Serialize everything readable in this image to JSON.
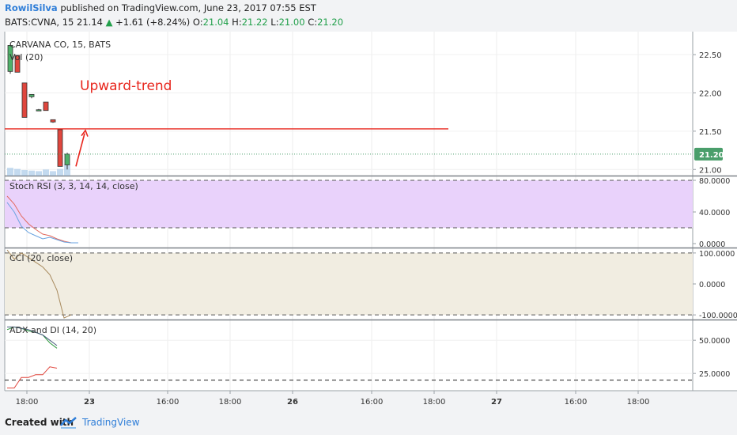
{
  "header": {
    "author": "RowilSilva",
    "published": "published on TradingView.com, June 23, 2017 07:55 EST",
    "symbol": "BATS:CVNA, 15",
    "last": "21.14",
    "arrow": "▲",
    "change": "+1.61 (+8.24%)",
    "o_label": "O:",
    "o_value": "21.04",
    "h_label": "H:",
    "h_value": "21.22",
    "l_label": "L:",
    "l_value": "21.00",
    "c_label": "C:",
    "c_value": "21.20"
  },
  "footer": {
    "created_with": "Created with",
    "brand": "TradingView"
  },
  "colors": {
    "up": "#22a04b",
    "down": "#e0463d",
    "annotation": "#e8261d",
    "rsi_fill": "#e9d2fb",
    "cci_fill": "#f1ede1",
    "price_badge": "#4a9e6b",
    "brand": "#2f7ed8"
  },
  "chart_data": [
    {
      "type": "candlestick",
      "title": "CARVANA CO, 15, BATS",
      "volume_label": "Vol (20)",
      "annotation": "Upward-trend",
      "horizontal_line_value": 21.53,
      "last_price_label": "21.20",
      "ylim": [
        20.92,
        22.8
      ],
      "yticks": [
        "22.50",
        "22.00",
        "21.50",
        "21.00"
      ],
      "x_tick_labels": [
        "18:00",
        "23",
        "16:00",
        "18:00",
        "26",
        "16:00",
        "18:00",
        "27",
        "16:00",
        "18:00"
      ],
      "bars": [
        {
          "open": 22.28,
          "high": 22.62,
          "low": 22.25,
          "close": 22.62
        },
        {
          "open": 22.49,
          "high": 22.49,
          "low": 22.27,
          "close": 22.27
        },
        {
          "open": 22.13,
          "high": 22.13,
          "low": 21.68,
          "close": 21.68
        },
        {
          "open": 21.95,
          "high": 21.98,
          "low": 21.93,
          "close": 21.98
        },
        {
          "open": 21.78,
          "high": 21.79,
          "low": 21.77,
          "close": 21.78
        },
        {
          "open": 21.88,
          "high": 21.88,
          "low": 21.77,
          "close": 21.77
        },
        {
          "open": 21.65,
          "high": 21.65,
          "low": 21.61,
          "close": 21.62
        },
        {
          "open": 21.52,
          "high": 21.52,
          "low": 21.04,
          "close": 21.04
        },
        {
          "open": 21.06,
          "high": 21.22,
          "low": 21.0,
          "close": 21.2
        }
      ],
      "volume": [
        0.7,
        0.6,
        0.5,
        0.45,
        0.4,
        0.55,
        0.4,
        0.6,
        1.0
      ]
    },
    {
      "type": "line",
      "title": "Stoch RSI (3, 3, 14, 14, close)",
      "ylim": [
        -5,
        85
      ],
      "yticks": [
        "80.0000",
        "40.0000",
        "0.0000"
      ],
      "band": [
        20,
        80
      ],
      "series": [
        {
          "color": "#e36a5e",
          "values": [
            60,
            50,
            35,
            25,
            18,
            12,
            10,
            6,
            3,
            1,
            1
          ]
        },
        {
          "color": "#6aa3e0",
          "values": [
            52,
            40,
            22,
            14,
            10,
            6,
            8,
            5,
            2,
            1,
            1
          ]
        }
      ]
    },
    {
      "type": "line",
      "title": "CCI (20, close)",
      "ylim": [
        -115,
        115
      ],
      "yticks": [
        "100.0000",
        "0.0000",
        "-100.0000"
      ],
      "band": [
        -100,
        100
      ],
      "series": [
        {
          "color": "#a88a5e",
          "values": [
            110,
            80,
            100,
            85,
            70,
            55,
            30,
            -20,
            -110,
            -100
          ]
        }
      ]
    },
    {
      "type": "line",
      "title": "ADX and DI (14, 20)",
      "ylim": [
        12,
        65
      ],
      "yticks": [
        "50.0000",
        "25.0000"
      ],
      "threshold": 20,
      "series": [
        {
          "color": "#e0463d",
          "values": [
            14,
            14,
            22,
            22,
            24,
            24,
            30,
            29
          ]
        },
        {
          "color": "#2e9a3e",
          "values": [
            58,
            60,
            59,
            57,
            56,
            54,
            48,
            44
          ]
        },
        {
          "color": "#4a5d7e",
          "values": [
            60,
            60,
            59,
            58,
            56,
            54,
            50,
            46
          ]
        }
      ]
    }
  ]
}
